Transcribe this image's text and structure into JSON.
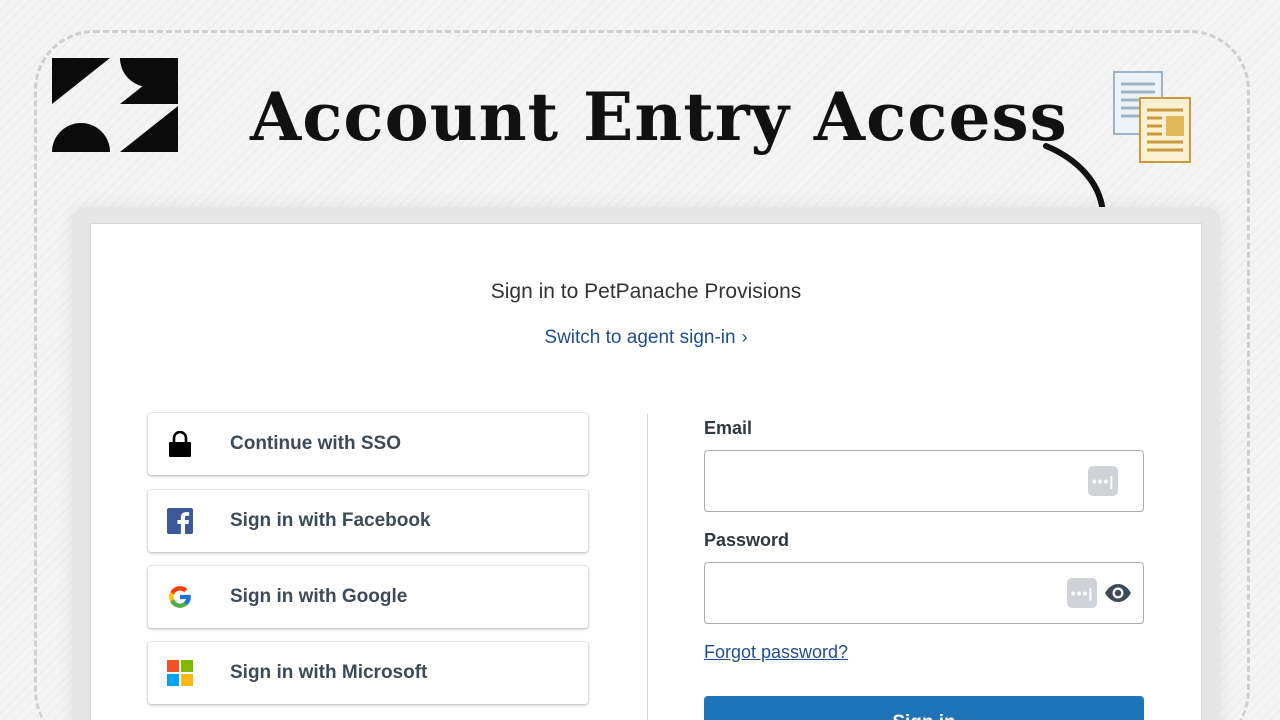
{
  "banner": {
    "headline": "Account Entry Access",
    "logo_icon": "zendesk-logo-icon",
    "docs_icon": "documents-icon",
    "arrow_icon": "curved-arrow-icon"
  },
  "signin": {
    "title": "Sign in to PetPanache Provisions",
    "switch_link": "Switch to agent sign-in",
    "switch_chevron": "›",
    "social": [
      {
        "label": "Continue with SSO",
        "icon": "lock-icon"
      },
      {
        "label": "Sign in with Facebook",
        "icon": "facebook-icon"
      },
      {
        "label": "Sign in with Google",
        "icon": "google-icon"
      },
      {
        "label": "Sign in with Microsoft",
        "icon": "microsoft-icon"
      }
    ],
    "email_label": "Email",
    "email_value": "",
    "password_label": "Password",
    "password_value": "",
    "password_manager_glyph": "•••|",
    "forgot_password": "Forgot password?",
    "submit_label": "Sign in"
  },
  "colors": {
    "link": "#1f4f8f",
    "primary_button": "#1f73b7",
    "facebook": "#3b5998"
  }
}
